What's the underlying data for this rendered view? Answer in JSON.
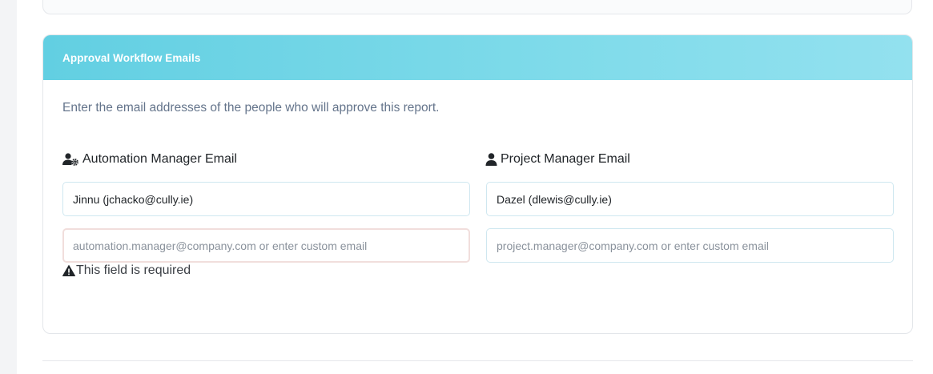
{
  "section": {
    "title": "Approval Workflow Emails",
    "intro": "Enter the email addresses of the people who will approve this report."
  },
  "automation_manager": {
    "label": "Automation Manager Email",
    "icon": "user-gear-icon",
    "selected_value": "Jinnu (jchacko@cully.ie)",
    "custom_placeholder": "automation.manager@company.com or enter custom email",
    "custom_value": "",
    "error": "This field is required",
    "error_icon": "warning-icon"
  },
  "project_manager": {
    "label": "Project Manager Email",
    "icon": "user-icon",
    "selected_value": "Dazel (dlewis@cully.ie)",
    "custom_placeholder": "project.manager@company.com or enter custom email",
    "custom_value": ""
  },
  "colors": {
    "header_gradient_start": "#62cfe2",
    "header_gradient_end": "#93e1ef",
    "error_border": "#f1dedc"
  }
}
